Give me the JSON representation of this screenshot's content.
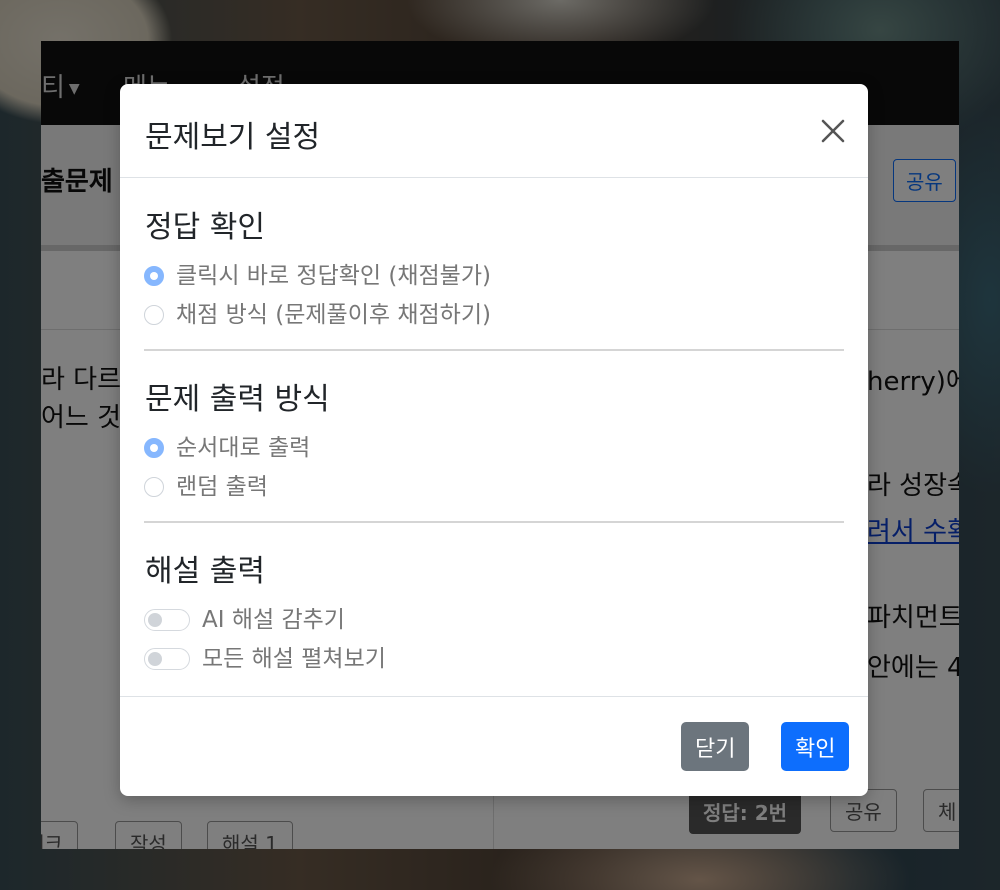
{
  "background_page": {
    "nav": {
      "item1": "티",
      "item2": "메뉴",
      "item3": "설정"
    },
    "title": "출문제",
    "share_label": "공유",
    "left_text_1": "라 다르",
    "left_text_2": "어느 것",
    "right_text_1": "herry)에",
    "right_text_2": "라 성장속",
    "right_link": "려서 수확",
    "right_text_3": "파치먼트,",
    "right_text_4": "안에는 4",
    "bottom_left": [
      "체크",
      "작성",
      "해설 1"
    ],
    "answer_badge": "정답: 2번",
    "bottom_share": "공유",
    "bottom_right_partial": "체"
  },
  "modal": {
    "title": "문제보기 설정",
    "sections": [
      {
        "title": "정답 확인",
        "options": [
          {
            "label": "클릭시 바로 정답확인 (채점불가)",
            "checked": true
          },
          {
            "label": "채점 방식 (문제풀이후 채점하기)",
            "checked": false
          }
        ]
      },
      {
        "title": "문제 출력 방식",
        "options": [
          {
            "label": "순서대로 출력",
            "checked": true
          },
          {
            "label": "랜덤 출력",
            "checked": false
          }
        ]
      },
      {
        "title": "해설 출력",
        "toggles": [
          {
            "label": "AI 해설 감추기",
            "on": false
          },
          {
            "label": "모든 해설 펼쳐보기",
            "on": false
          }
        ]
      }
    ],
    "buttons": {
      "close": "닫기",
      "ok": "확인"
    }
  },
  "colors": {
    "primary": "#0d6efd",
    "secondary": "#6c757d",
    "radio_checked": "#86b7fe"
  },
  "icons": {
    "close": "close-icon",
    "caret": "caret-down-icon"
  }
}
